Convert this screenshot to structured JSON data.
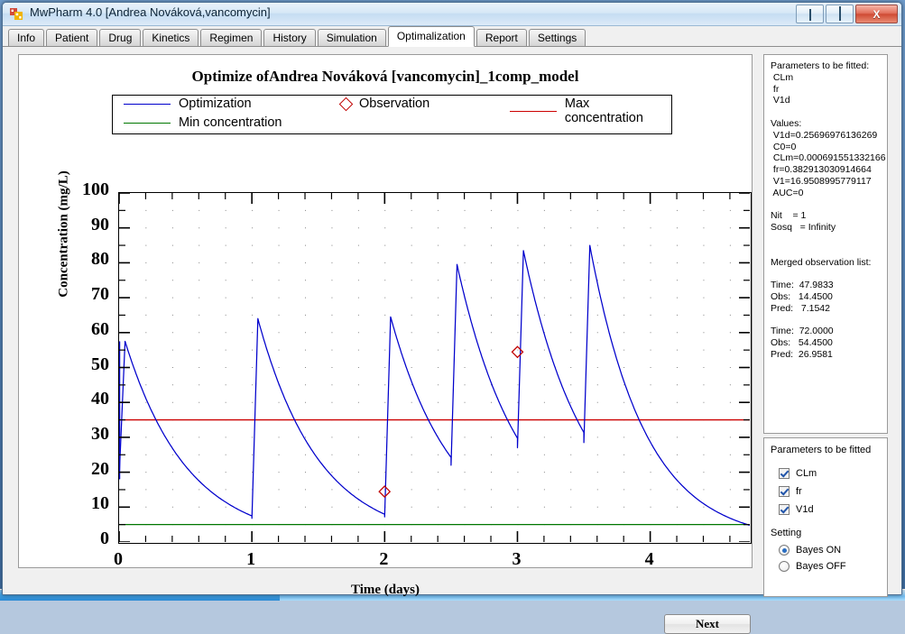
{
  "window": {
    "title": "MwPharm 4.0  [Andrea Nováková,vancomycin]",
    "icon": "app-icon",
    "minimize_label": "minimize",
    "maximize_label": "maximize",
    "close_label": "X"
  },
  "tabs": [
    {
      "label": "Info",
      "active": false
    },
    {
      "label": "Patient",
      "active": false
    },
    {
      "label": "Drug",
      "active": false
    },
    {
      "label": "Kinetics",
      "active": false
    },
    {
      "label": "Regimen",
      "active": false
    },
    {
      "label": "History",
      "active": false
    },
    {
      "label": "Simulation",
      "active": false
    },
    {
      "label": "Optimalization",
      "active": true
    },
    {
      "label": "Report",
      "active": false
    },
    {
      "label": "Settings",
      "active": false
    }
  ],
  "info_panel": {
    "text": "Parameters to be fitted:\n CLm\n fr\n V1d\n\nValues:\n V1d=0.25696976136269\n C0=0\n CLm=0.000691551332166…\n fr=0.382913030914664\n V1=16.9508995779117\n AUC=0\n\nNit    = 1\nSosq   = Infinity\n\n\nMerged observation list:\n\nTime:  47.9833\nObs:   14.4500\nPred:   7.1542\n\nTime:  72.0000\nObs:   54.4500\nPred:  26.9581"
  },
  "fit_panel": {
    "title": "Parameters to be fitted",
    "checkboxes": [
      {
        "label": "CLm",
        "checked": true
      },
      {
        "label": "fr",
        "checked": true
      },
      {
        "label": "V1d",
        "checked": true
      }
    ],
    "setting_label": "Setting",
    "radios": [
      {
        "label": "Bayes ON",
        "selected": true
      },
      {
        "label": "Bayes OFF",
        "selected": false
      }
    ]
  },
  "footer": {
    "next_label": "Next"
  },
  "chart_data": {
    "type": "line",
    "title": "Optimize ofAndrea Nováková [vancomycin]_1comp_model",
    "xlabel": "Time (days)",
    "ylabel": "Concentration (mg/L)",
    "xlim": [
      0,
      4.75
    ],
    "ylim": [
      0,
      100
    ],
    "xticks": [
      0,
      1,
      2,
      3,
      4
    ],
    "yticks": [
      0,
      10,
      20,
      30,
      40,
      50,
      60,
      70,
      80,
      90,
      100
    ],
    "x_minor_step": 0.2,
    "y_minor_step": 5,
    "grid": "dotted",
    "legend_position": "top",
    "legend": [
      {
        "name": "Optimization",
        "color": "#0000cc",
        "style": "line"
      },
      {
        "name": "Observation",
        "color": "#c00000",
        "style": "diamond"
      },
      {
        "name": "Max concentration",
        "color": "#cc0000",
        "style": "line"
      },
      {
        "name": "Min concentration",
        "color": "#007700",
        "style": "line"
      }
    ],
    "reference_lines": [
      {
        "name": "Max concentration",
        "value": 35,
        "color": "#cc0000"
      },
      {
        "name": "Min concentration",
        "value": 5,
        "color": "#007700"
      }
    ],
    "observations": [
      {
        "time_days": 1.999,
        "time_hours": 47.9833,
        "obs": 14.45,
        "pred": 7.1542
      },
      {
        "time_days": 3.0,
        "time_hours": 72.0,
        "obs": 54.45,
        "pred": 26.9581
      }
    ],
    "series": [
      {
        "name": "Optimization",
        "color": "#0000cc",
        "doses": [
          {
            "t_start": 0.0,
            "c_peak": 57.5,
            "c_trough": 6.8,
            "t_end": 1.0
          },
          {
            "t_start": 1.0,
            "c_peak": 64.0,
            "c_trough": 7.2,
            "t_end": 2.0
          },
          {
            "t_start": 2.0,
            "c_peak": 64.5,
            "c_trough": 22.0,
            "t_end": 2.5
          },
          {
            "t_start": 2.5,
            "c_peak": 79.5,
            "c_trough": 27.0,
            "t_end": 3.0
          },
          {
            "t_start": 3.0,
            "c_peak": 83.5,
            "c_trough": 28.5,
            "t_end": 3.5
          },
          {
            "t_start": 3.5,
            "c_peak": 85.0,
            "c_trough": 4.3,
            "t_end": 4.75
          }
        ]
      }
    ]
  }
}
